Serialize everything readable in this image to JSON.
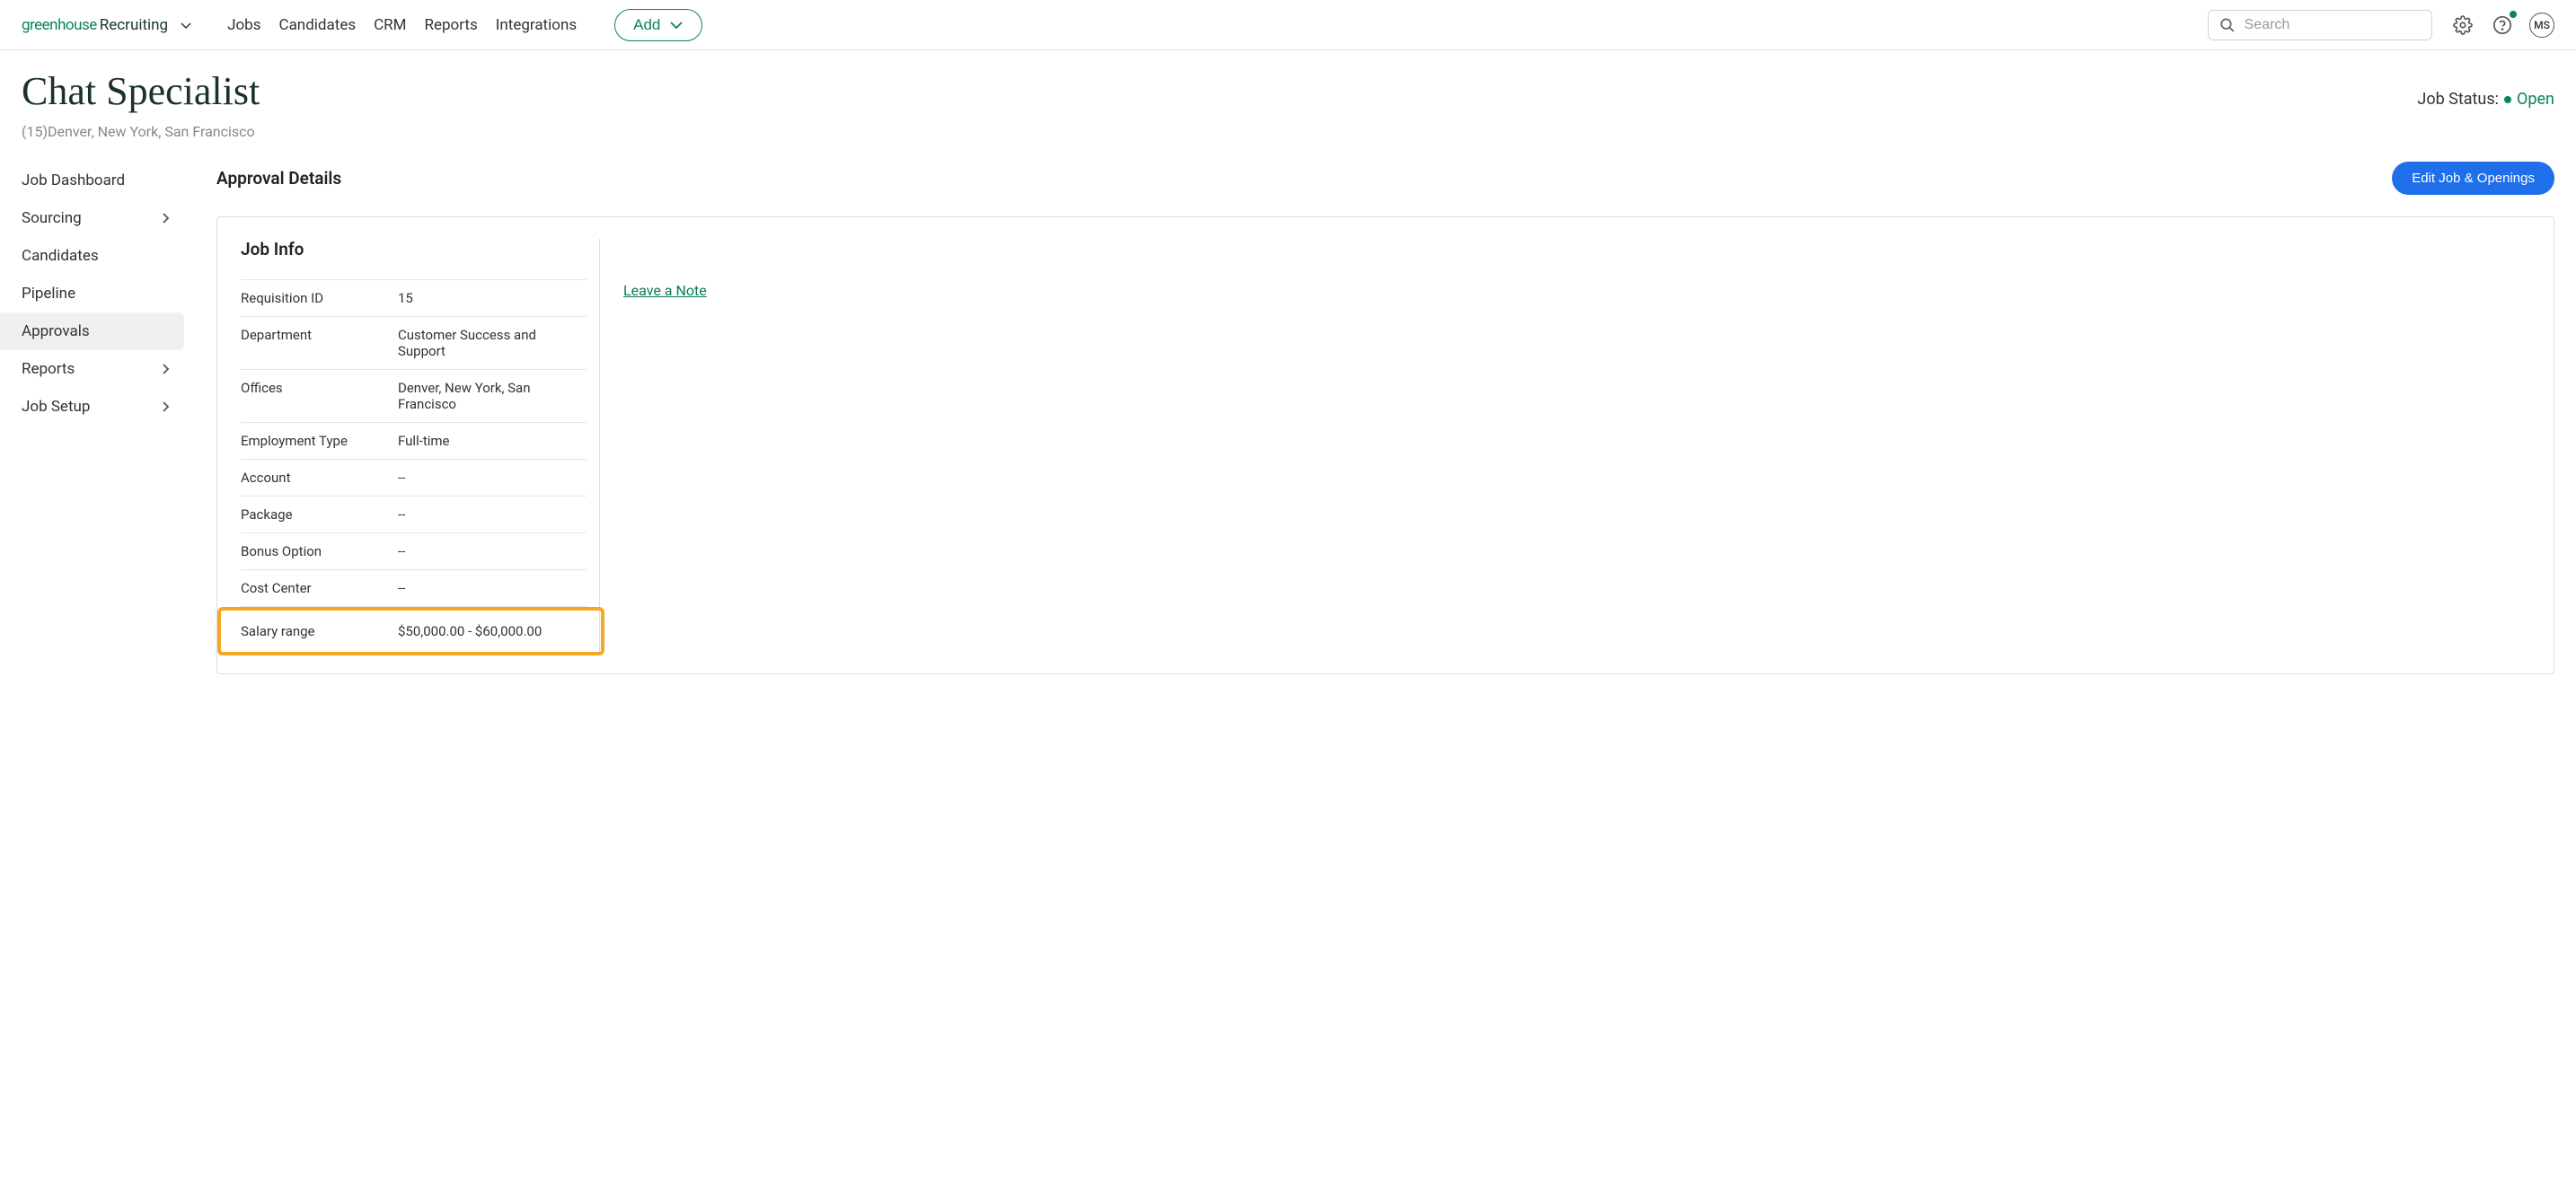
{
  "logo": {
    "brand": "greenhouse",
    "product": "Recruiting"
  },
  "nav": {
    "links": [
      "Jobs",
      "Candidates",
      "CRM",
      "Reports",
      "Integrations"
    ],
    "add_label": "Add",
    "search_placeholder": "Search",
    "avatar_initials": "MS"
  },
  "header": {
    "title": "Chat Specialist",
    "subtitle": "(15)Denver, New York, San Francisco",
    "status_label": "Job Status:",
    "status_value": "Open"
  },
  "sidebar": {
    "items": [
      {
        "label": "Job Dashboard",
        "chevron": false
      },
      {
        "label": "Sourcing",
        "chevron": true
      },
      {
        "label": "Candidates",
        "chevron": false
      },
      {
        "label": "Pipeline",
        "chevron": false
      },
      {
        "label": "Approvals",
        "chevron": false,
        "active": true
      },
      {
        "label": "Reports",
        "chevron": true
      },
      {
        "label": "Job Setup",
        "chevron": true
      }
    ]
  },
  "main": {
    "section_title": "Approval Details",
    "edit_button": "Edit Job & Openings",
    "panel_title": "Job Info",
    "leave_note": "Leave a Note",
    "info": [
      {
        "label": "Requisition ID",
        "value": "15"
      },
      {
        "label": "Department",
        "value": "Customer Success and Support"
      },
      {
        "label": "Offices",
        "value": "Denver, New York, San Francisco"
      },
      {
        "label": "Employment Type",
        "value": "Full-time"
      },
      {
        "label": "Account",
        "value": "--"
      },
      {
        "label": "Package",
        "value": "--"
      },
      {
        "label": "Bonus Option",
        "value": "--"
      },
      {
        "label": "Cost Center",
        "value": "--"
      },
      {
        "label": "Salary range",
        "value": "$50,000.00 - $60,000.00",
        "highlighted": true
      }
    ]
  }
}
